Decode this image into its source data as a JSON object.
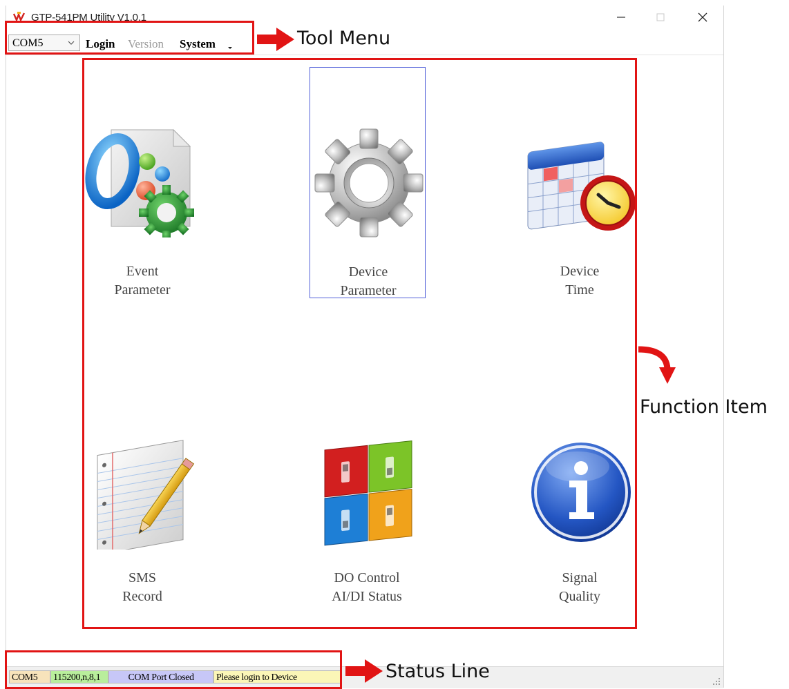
{
  "window": {
    "title": "GTP-541PM Utility V1.0.1",
    "controls": {
      "minimize": "–",
      "maximize": "☐",
      "close": "✕"
    }
  },
  "toolbar": {
    "port_select": "COM5",
    "login": "Login",
    "version": "Version",
    "system": "System"
  },
  "functions": {
    "event": {
      "line1": "Event",
      "line2": "Parameter",
      "icon": "event-parameter-icon"
    },
    "device_param": {
      "line1": "Device",
      "line2": "Parameter",
      "icon": "gear-icon"
    },
    "device_time": {
      "line1": "Device",
      "line2": "Time",
      "icon": "calendar-clock-icon"
    },
    "sms": {
      "line1": "SMS",
      "line2": "Record",
      "icon": "notepad-pencil-icon"
    },
    "do_control": {
      "line1": "DO Control",
      "line2": "AI/DI Status",
      "icon": "switches-icon"
    },
    "signal": {
      "line1": "Signal",
      "line2": "Quality",
      "icon": "info-icon"
    }
  },
  "status": {
    "port": "COM5",
    "baud": "115200,n,8,1",
    "port_state": "COM Port Closed",
    "message": "Please login to Device"
  },
  "annotations": {
    "tool_menu": "Tool Menu",
    "function_item": "Function Item",
    "status_line": "Status Line"
  },
  "colors": {
    "annotation_red": "#e11414",
    "status_port_bg": "#f7e3bb",
    "status_baud_bg": "#b9ee9c",
    "status_state_bg": "#c7c7f7",
    "status_msg_bg": "#fbf6b7",
    "selection_border": "#4f5ed8"
  }
}
